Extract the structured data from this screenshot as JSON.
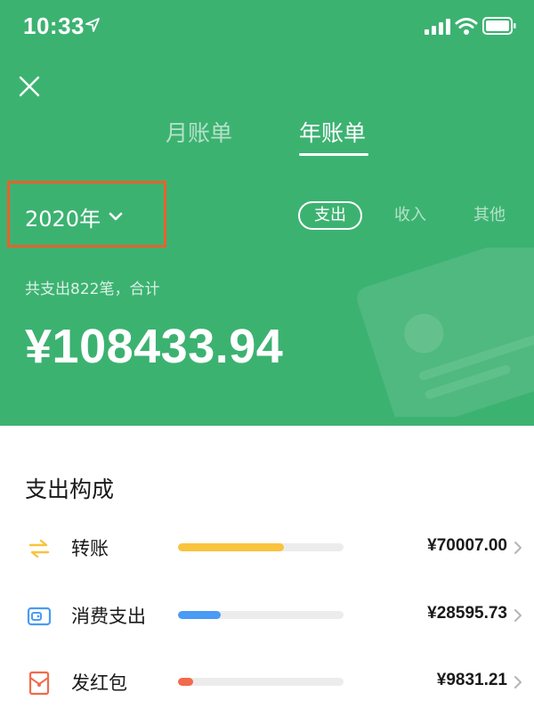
{
  "status_bar": {
    "time": "10:33"
  },
  "header": {
    "tabs": [
      {
        "label": "月账单",
        "active": false
      },
      {
        "label": "年账单",
        "active": true
      }
    ]
  },
  "filter": {
    "year": "2020年",
    "chips": [
      {
        "label": "支出",
        "active": true
      },
      {
        "label": "收入",
        "active": false
      },
      {
        "label": "其他",
        "active": false
      }
    ]
  },
  "summary": {
    "text": "共支出822笔，合计",
    "total": "¥108433.94"
  },
  "breakdown": {
    "title": "支出构成",
    "items": [
      {
        "label": "转账",
        "amount": "¥70007.00",
        "bar_fraction": 0.64,
        "color": "#f9c33d",
        "icon": "transfer-icon"
      },
      {
        "label": "消费支出",
        "amount": "¥28595.73",
        "bar_fraction": 0.26,
        "color": "#4a9bf5",
        "icon": "wallet-icon"
      },
      {
        "label": "发红包",
        "amount": "¥9831.21",
        "bar_fraction": 0.09,
        "color": "#f26a4b",
        "icon": "red-packet-icon"
      }
    ]
  },
  "colors": {
    "brand_green": "#3cb271",
    "highlight": "#e8612c"
  }
}
